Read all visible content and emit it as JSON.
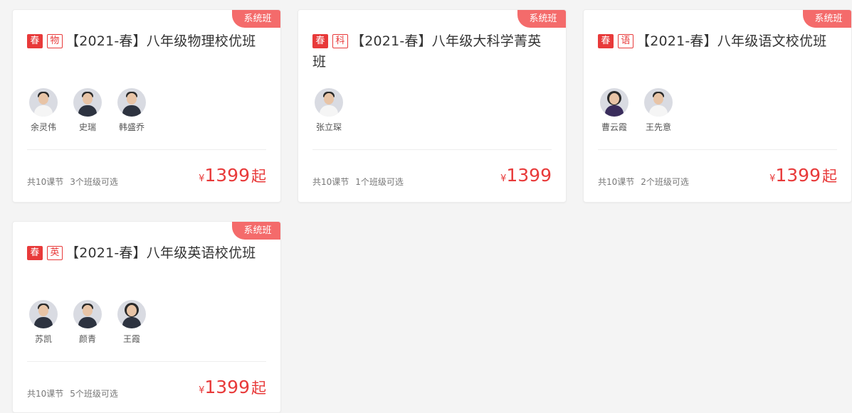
{
  "cards": [
    {
      "ribbon": "系统班",
      "season_tag": "春",
      "subject_tag": "物",
      "title": "【2021-春】八年级物理校优班",
      "teachers": [
        {
          "name": "余灵伟",
          "style": "light"
        },
        {
          "name": "史瑞",
          "style": "dark"
        },
        {
          "name": "韩盛乔",
          "style": "dark"
        }
      ],
      "lessons": "共10课节",
      "classes": "3个班级可选",
      "currency": "¥",
      "price": "1399",
      "price_suffix": "起"
    },
    {
      "ribbon": "系统班",
      "season_tag": "春",
      "subject_tag": "科",
      "title": "【2021-春】八年级大科学菁英班",
      "teachers": [
        {
          "name": "张立琛",
          "style": "light"
        }
      ],
      "lessons": "共10课节",
      "classes": "1个班级可选",
      "currency": "¥",
      "price": "1399",
      "price_suffix": ""
    },
    {
      "ribbon": "系统班",
      "season_tag": "春",
      "subject_tag": "语",
      "title": "【2021-春】八年级语文校优班",
      "teachers": [
        {
          "name": "曹云霞",
          "style": "female-purple"
        },
        {
          "name": "王先意",
          "style": "light"
        }
      ],
      "lessons": "共10课节",
      "classes": "2个班级可选",
      "currency": "¥",
      "price": "1399",
      "price_suffix": "起"
    },
    {
      "ribbon": "系统班",
      "season_tag": "春",
      "subject_tag": "英",
      "title": "【2021-春】八年级英语校优班",
      "teachers": [
        {
          "name": "苏凯",
          "style": "dark"
        },
        {
          "name": "颜青",
          "style": "dark"
        },
        {
          "name": "王霞",
          "style": "female-dark"
        }
      ],
      "lessons": "共10课节",
      "classes": "5个班级可选",
      "currency": "¥",
      "price": "1399",
      "price_suffix": "起"
    }
  ],
  "colors": {
    "accent": "#e83a3a",
    "ribbon": "#f46b6b",
    "background": "#f4f4f4"
  }
}
